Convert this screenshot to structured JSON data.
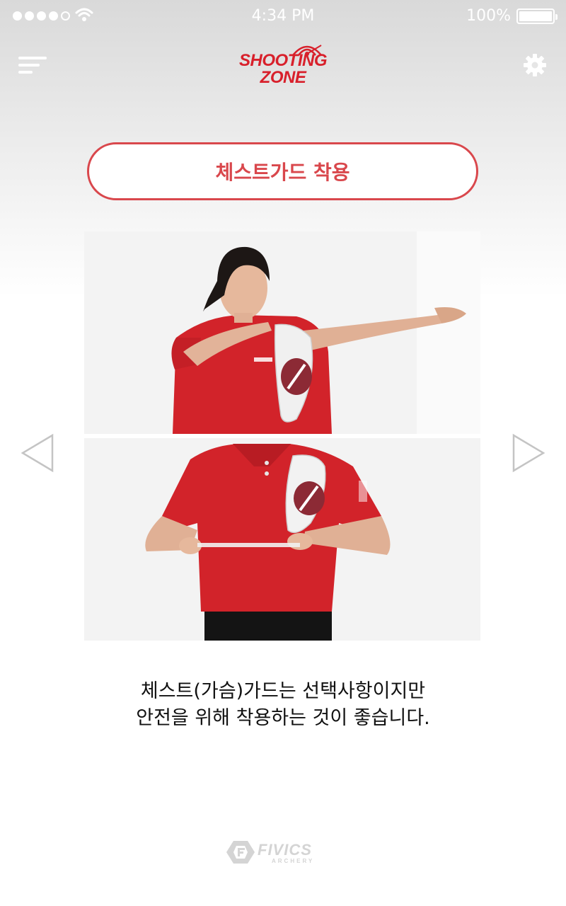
{
  "status_bar": {
    "time": "4:34 PM",
    "battery_percent": "100%",
    "signal_bars": 4,
    "signal_total": 5
  },
  "header": {
    "logo_line1": "SHOOTING",
    "logo_line2": "ZONE",
    "menu_icon": "hamburger-menu-icon",
    "settings_icon": "gear-icon"
  },
  "page": {
    "title": "체스트가드 착용",
    "caption_line1": "체스트(가슴)가드는 선택사항이지만",
    "caption_line2": "안전을 위해 착용하는 것이 좋습니다."
  },
  "navigation": {
    "prev_icon": "triangle-left-icon",
    "next_icon": "triangle-right-icon"
  },
  "footer": {
    "brand": "FIVICS",
    "brand_sub": "ARCHERY"
  },
  "colors": {
    "accent": "#d9474c",
    "brand_red": "#d8202b",
    "shirt_red": "#d2232a"
  }
}
